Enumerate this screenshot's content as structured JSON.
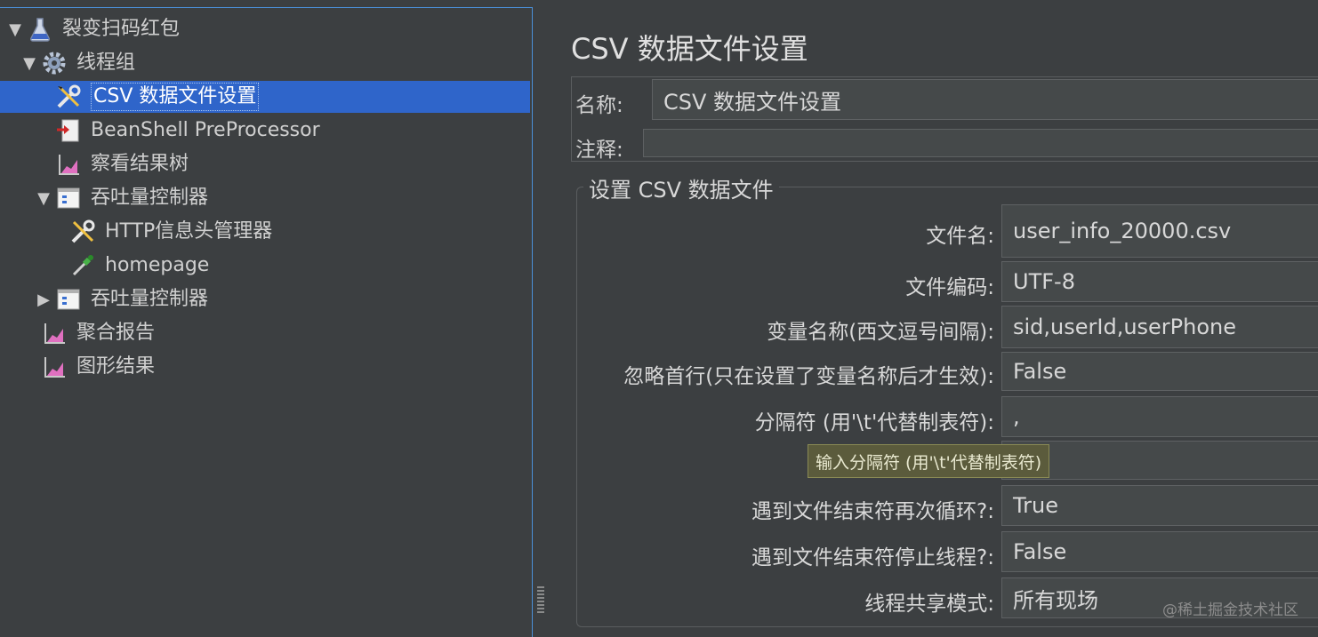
{
  "tree": {
    "nodes": [
      {
        "label": "裂变扫码红包",
        "icon": "flask-icon",
        "arrow": "▼"
      },
      {
        "label": "线程组",
        "icon": "gear-icon",
        "arrow": "▼"
      },
      {
        "label": "CSV 数据文件设置",
        "icon": "wrench-screwdriver-icon",
        "arrow": ""
      },
      {
        "label": "BeanShell PreProcessor",
        "icon": "preprocessor-icon",
        "arrow": ""
      },
      {
        "label": "察看结果树",
        "icon": "listener-chart-icon",
        "arrow": ""
      },
      {
        "label": "吞吐量控制器",
        "icon": "controller-icon",
        "arrow": "▼"
      },
      {
        "label": "HTTP信息头管理器",
        "icon": "wrench-screwdriver-icon",
        "arrow": ""
      },
      {
        "label": "homepage",
        "icon": "pipette-sampler-icon",
        "arrow": ""
      },
      {
        "label": "吞吐量控制器",
        "icon": "controller-icon",
        "arrow": "▶"
      },
      {
        "label": "聚合报告",
        "icon": "listener-chart-icon",
        "arrow": ""
      },
      {
        "label": "图形结果",
        "icon": "listener-chart-icon",
        "arrow": ""
      }
    ],
    "selected_label": "CSV 数据文件设置"
  },
  "panel": {
    "title": "CSV 数据文件设置",
    "name_label": "名称:",
    "name_value": "CSV 数据文件设置",
    "comment_label": "注释:",
    "comment_value": "",
    "group_title": "设置 CSV 数据文件",
    "fields": [
      {
        "label": "文件名:",
        "value": "user_info_20000.csv"
      },
      {
        "label": "文件编码:",
        "value": "UTF-8"
      },
      {
        "label": "变量名称(西文逗号间隔):",
        "value": "sid,userId,userPhone"
      },
      {
        "label": "忽略首行(只在设置了变量名称后才生效):",
        "value": "False"
      },
      {
        "label": "分隔符 (用'\\t'代替制表符):",
        "value": ","
      },
      {
        "label": "",
        "value": ""
      },
      {
        "label": "遇到文件结束符再次循环?:",
        "value": "True"
      },
      {
        "label": "遇到文件结束符停止线程?:",
        "value": "False"
      },
      {
        "label": "线程共享模式:",
        "value": "所有现场"
      }
    ],
    "tooltip": "输入分隔符 (用'\\t'代替制表符)"
  },
  "watermark": "@稀土掘金技术社区"
}
